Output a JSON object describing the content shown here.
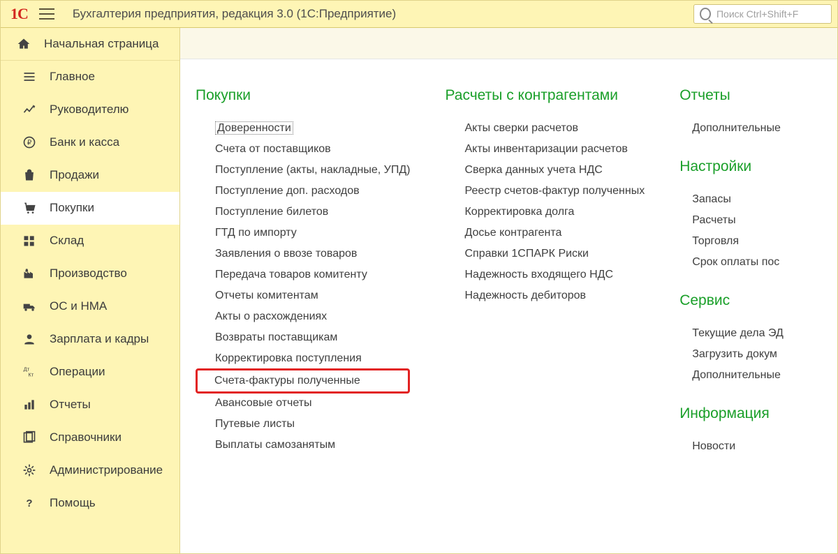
{
  "header": {
    "title": "Бухгалтерия предприятия, редакция 3.0  (1С:Предприятие)",
    "search_placeholder": "Поиск Ctrl+Shift+F"
  },
  "sidebar": {
    "home": "Начальная страница",
    "items": [
      {
        "icon": "lines",
        "label": "Главное"
      },
      {
        "icon": "chart",
        "label": "Руководителю"
      },
      {
        "icon": "ruble",
        "label": "Банк и касса"
      },
      {
        "icon": "bag",
        "label": "Продажи"
      },
      {
        "icon": "cart",
        "label": "Покупки"
      },
      {
        "icon": "grid",
        "label": "Склад"
      },
      {
        "icon": "factory",
        "label": "Производство"
      },
      {
        "icon": "truck",
        "label": "ОС и НМА"
      },
      {
        "icon": "person",
        "label": "Зарплата и кадры"
      },
      {
        "icon": "dtkt",
        "label": "Операции"
      },
      {
        "icon": "bars",
        "label": "Отчеты"
      },
      {
        "icon": "books",
        "label": "Справочники"
      },
      {
        "icon": "gear",
        "label": "Администрирование"
      },
      {
        "icon": "help",
        "label": "Помощь"
      }
    ],
    "active_index": 4
  },
  "main": {
    "columns": [
      {
        "groups": [
          {
            "title": "Покупки",
            "links": [
              {
                "label": "Доверенности",
                "selected": true
              },
              {
                "label": "Счета от поставщиков"
              },
              {
                "label": "Поступление (акты, накладные, УПД)"
              },
              {
                "label": "Поступление доп. расходов"
              },
              {
                "label": "Поступление билетов"
              },
              {
                "label": "ГТД по импорту"
              },
              {
                "label": "Заявления о ввозе товаров"
              },
              {
                "label": "Передача товаров комитенту"
              },
              {
                "label": "Отчеты комитентам"
              },
              {
                "label": "Акты о расхождениях"
              },
              {
                "label": "Возвраты поставщикам"
              },
              {
                "label": "Корректировка поступления"
              },
              {
                "label": "Счета-фактуры полученные",
                "highlighted": true
              },
              {
                "label": "Авансовые отчеты"
              },
              {
                "label": "Путевые листы"
              },
              {
                "label": "Выплаты самозанятым"
              }
            ]
          }
        ]
      },
      {
        "groups": [
          {
            "title": "Расчеты с контрагентами",
            "links": [
              {
                "label": "Акты сверки расчетов"
              },
              {
                "label": "Акты инвентаризации расчетов"
              },
              {
                "label": "Сверка данных учета НДС"
              },
              {
                "label": "Реестр счетов-фактур полученных"
              },
              {
                "label": "Корректировка долга"
              },
              {
                "label": "Досье контрагента"
              },
              {
                "label": "Справки 1СПАРК Риски"
              },
              {
                "label": "Надежность входящего НДС"
              },
              {
                "label": "Надежность дебиторов"
              }
            ]
          }
        ]
      },
      {
        "groups": [
          {
            "title": "Отчеты",
            "links": [
              {
                "label": "Дополнительные"
              }
            ]
          },
          {
            "title": "Настройки",
            "links": [
              {
                "label": "Запасы"
              },
              {
                "label": "Расчеты"
              },
              {
                "label": "Торговля"
              },
              {
                "label": "Срок оплаты пос"
              }
            ]
          },
          {
            "title": "Сервис",
            "links": [
              {
                "label": "Текущие дела ЭД"
              },
              {
                "label": "Загрузить докум"
              },
              {
                "label": "Дополнительные"
              }
            ]
          },
          {
            "title": "Информация",
            "links": [
              {
                "label": "Новости"
              }
            ]
          }
        ]
      }
    ]
  }
}
